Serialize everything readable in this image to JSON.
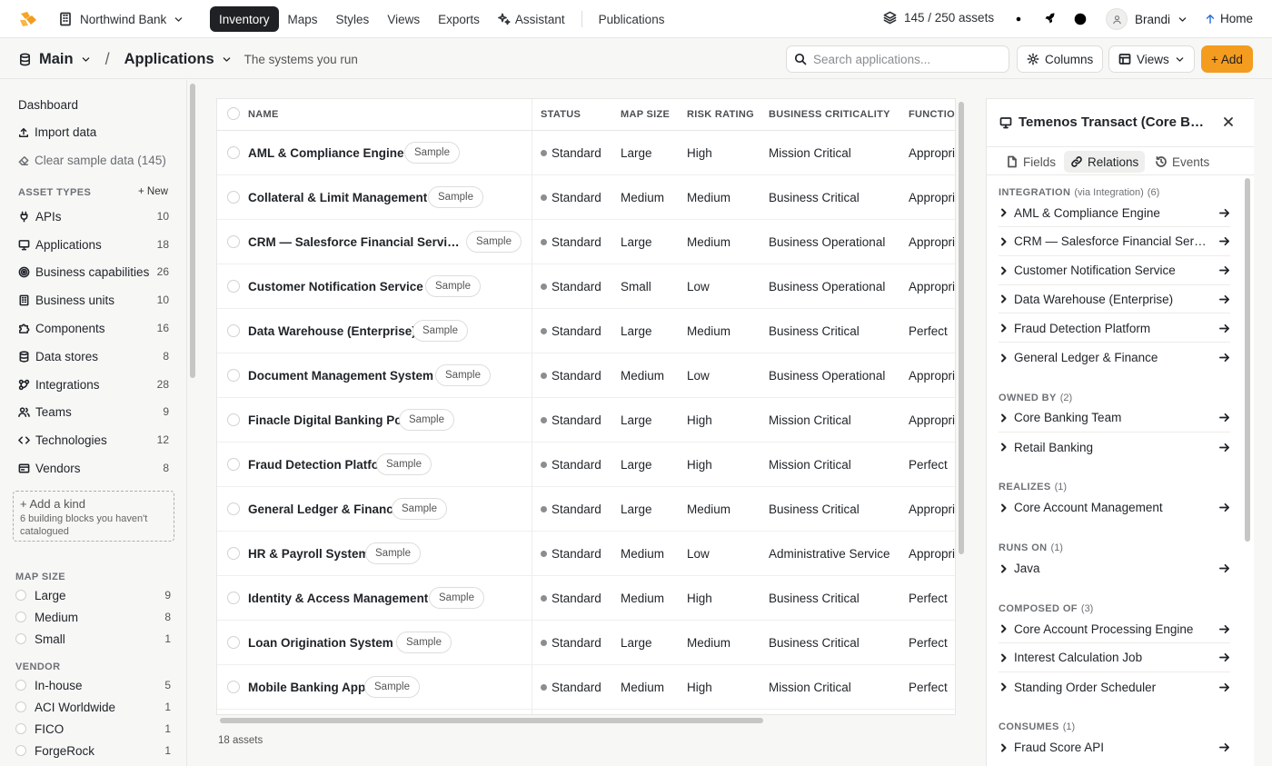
{
  "topbar": {
    "org": "Northwind Bank",
    "nav": [
      {
        "label": "Inventory",
        "active": true
      },
      {
        "label": "Maps"
      },
      {
        "label": "Styles"
      },
      {
        "label": "Views"
      },
      {
        "label": "Exports"
      },
      {
        "label": "Assistant"
      }
    ],
    "publications": "Publications",
    "assets_count": "145 / 250 assets",
    "user": "Brandi",
    "home": "Home",
    "colors": {
      "active_tab": "#1f2124",
      "accent": "#f39c1f"
    }
  },
  "subheader": {
    "workspace": "Main",
    "page": "Applications",
    "description": "The systems you run",
    "search_placeholder": "Search applications...",
    "columns_label": "Columns",
    "views_label": "Views",
    "add_label": "+ Add"
  },
  "sidebar": {
    "dashboard": "Dashboard",
    "import": "Import data",
    "clear": "Clear sample data (145)",
    "asset_types_heading": "ASSET TYPES",
    "new_label": "+ New",
    "items": [
      {
        "label": "APIs",
        "count": "10",
        "icon": "api-icon"
      },
      {
        "label": "Applications",
        "count": "18",
        "icon": "monitor-icon"
      },
      {
        "label": "Business capabilities",
        "count": "26",
        "icon": "target-icon"
      },
      {
        "label": "Business units",
        "count": "10",
        "icon": "building-icon"
      },
      {
        "label": "Components",
        "count": "16",
        "icon": "puzzle-icon"
      },
      {
        "label": "Data stores",
        "count": "8",
        "icon": "database-icon"
      },
      {
        "label": "Integrations",
        "count": "28",
        "icon": "integration-icon"
      },
      {
        "label": "Teams",
        "count": "9",
        "icon": "people-icon"
      },
      {
        "label": "Technologies",
        "count": "12",
        "icon": "code-icon"
      },
      {
        "label": "Vendors",
        "count": "8",
        "icon": "vendor-icon"
      }
    ],
    "add_kind": "+ Add a kind",
    "add_kind_sub": "6 building blocks you haven't catalogued",
    "map_size_heading": "MAP SIZE",
    "map_sizes": [
      {
        "label": "Large",
        "count": "9"
      },
      {
        "label": "Medium",
        "count": "8"
      },
      {
        "label": "Small",
        "count": "1"
      }
    ],
    "vendor_heading": "VENDOR",
    "vendors": [
      {
        "label": "In-house",
        "count": "5"
      },
      {
        "label": "ACI Worldwide",
        "count": "1"
      },
      {
        "label": "FICO",
        "count": "1"
      },
      {
        "label": "ForgeRock",
        "count": "1"
      }
    ]
  },
  "table": {
    "columns": [
      "NAME",
      "STATUS",
      "MAP SIZE",
      "RISK RATING",
      "BUSINESS CRITICALITY",
      "FUNCTION"
    ],
    "badge_label": "Sample",
    "rows": [
      {
        "name": "AML & Compliance Engine",
        "status": "Standard",
        "size": "Large",
        "risk": "High",
        "crit": "Mission Critical",
        "func": "Appropriate"
      },
      {
        "name": "Collateral & Limit Management",
        "status": "Standard",
        "size": "Medium",
        "risk": "Medium",
        "crit": "Business Critical",
        "func": "Appropriate"
      },
      {
        "name": "CRM — Salesforce Financial Services ...",
        "status": "Standard",
        "size": "Large",
        "risk": "Medium",
        "crit": "Business Operational",
        "func": "Appropriate"
      },
      {
        "name": "Customer Notification Service",
        "status": "Standard",
        "size": "Small",
        "risk": "Low",
        "crit": "Business Operational",
        "func": "Appropriate"
      },
      {
        "name": "Data Warehouse (Enterprise)",
        "status": "Standard",
        "size": "Large",
        "risk": "Medium",
        "crit": "Business Critical",
        "func": "Perfect"
      },
      {
        "name": "Document Management System",
        "status": "Standard",
        "size": "Medium",
        "risk": "Low",
        "crit": "Business Operational",
        "func": "Appropriate"
      },
      {
        "name": "Finacle Digital Banking Portal",
        "status": "Standard",
        "size": "Large",
        "risk": "High",
        "crit": "Mission Critical",
        "func": "Appropriate"
      },
      {
        "name": "Fraud Detection Platform",
        "status": "Standard",
        "size": "Large",
        "risk": "High",
        "crit": "Mission Critical",
        "func": "Perfect"
      },
      {
        "name": "General Ledger & Finance",
        "status": "Standard",
        "size": "Large",
        "risk": "Medium",
        "crit": "Business Critical",
        "func": "Appropriate"
      },
      {
        "name": "HR & Payroll System",
        "status": "Standard",
        "size": "Medium",
        "risk": "Low",
        "crit": "Administrative Service",
        "func": "Appropriate"
      },
      {
        "name": "Identity & Access Management",
        "status": "Standard",
        "size": "Medium",
        "risk": "High",
        "crit": "Business Critical",
        "func": "Perfect"
      },
      {
        "name": "Loan Origination System",
        "status": "Standard",
        "size": "Large",
        "risk": "Medium",
        "crit": "Business Critical",
        "func": "Perfect"
      },
      {
        "name": "Mobile Banking App",
        "status": "Standard",
        "size": "Medium",
        "risk": "High",
        "crit": "Mission Critical",
        "func": "Perfect"
      }
    ],
    "footer": "18 assets"
  },
  "panel": {
    "title": "Temenos Transact (Core Banking)",
    "tabs": [
      {
        "label": "Fields",
        "icon": "document-icon"
      },
      {
        "label": "Relations",
        "icon": "link-icon",
        "active": true
      },
      {
        "label": "Events",
        "icon": "history-icon"
      }
    ],
    "groups": [
      {
        "title": "INTEGRATION",
        "sub": "(via Integration)",
        "count": "(6)",
        "items": [
          "AML & Compliance Engine",
          "CRM — Salesforce Financial Services Cloud",
          "Customer Notification Service",
          "Data Warehouse (Enterprise)",
          "Fraud Detection Platform",
          "General Ledger & Finance"
        ]
      },
      {
        "title": "OWNED BY",
        "sub": "",
        "count": "(2)",
        "items": [
          "Core Banking Team",
          "Retail Banking"
        ]
      },
      {
        "title": "REALIZES",
        "sub": "",
        "count": "(1)",
        "items": [
          "Core Account Management"
        ]
      },
      {
        "title": "RUNS ON",
        "sub": "",
        "count": "(1)",
        "items": [
          "Java"
        ]
      },
      {
        "title": "COMPOSED OF",
        "sub": "",
        "count": "(3)",
        "items": [
          "Core Account Processing Engine",
          "Interest Calculation Job",
          "Standing Order Scheduler"
        ]
      },
      {
        "title": "CONSUMES",
        "sub": "",
        "count": "(1)",
        "items": [
          "Fraud Score API"
        ]
      }
    ]
  }
}
